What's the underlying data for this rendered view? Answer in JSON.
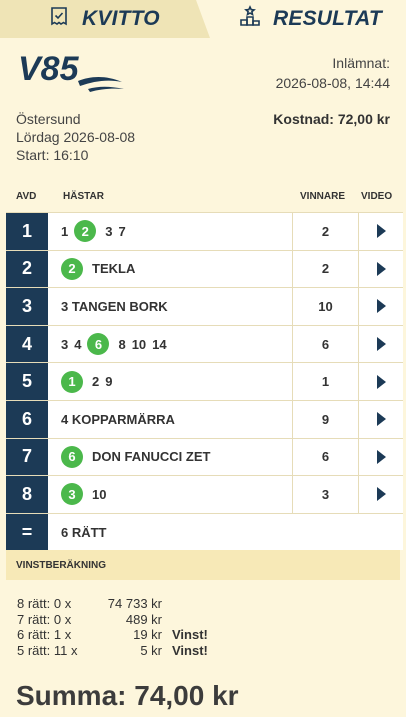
{
  "tabs": {
    "kvitto": "KVITTO",
    "resultat": "RESULTAT"
  },
  "header": {
    "logo": "V85",
    "inlamnat_label": "Inlämnat:",
    "inlamnat_value": "2026-08-08, 14:44",
    "track": "Östersund",
    "date": "Lördag 2026-08-08",
    "start": "Start: 16:10",
    "kostnad": "Kostnad: 72,00 kr"
  },
  "columns": {
    "avd": "AVD",
    "hastar": "HÄSTAR",
    "vinnare": "VINNARE",
    "video": "VIDEO"
  },
  "rows": [
    {
      "avd": "1",
      "horses": [
        {
          "t": "1",
          "w": false
        },
        {
          "t": "2",
          "w": true
        },
        {
          "t": "3",
          "w": false
        },
        {
          "t": "7",
          "w": false
        }
      ],
      "vinnare": "2"
    },
    {
      "avd": "2",
      "horses": [
        {
          "t": "2",
          "w": true
        },
        {
          "t": "TEKLA",
          "w": false
        }
      ],
      "vinnare": "2"
    },
    {
      "avd": "3",
      "horses": [
        {
          "t": "3 TANGEN BORK",
          "w": false
        }
      ],
      "vinnare": "10"
    },
    {
      "avd": "4",
      "horses": [
        {
          "t": "3",
          "w": false
        },
        {
          "t": "4",
          "w": false
        },
        {
          "t": "6",
          "w": true
        },
        {
          "t": "8",
          "w": false
        },
        {
          "t": "10",
          "w": false
        },
        {
          "t": "14",
          "w": false
        }
      ],
      "vinnare": "6"
    },
    {
      "avd": "5",
      "horses": [
        {
          "t": "1",
          "w": true
        },
        {
          "t": "2",
          "w": false
        },
        {
          "t": "9",
          "w": false
        }
      ],
      "vinnare": "1"
    },
    {
      "avd": "6",
      "horses": [
        {
          "t": "4 KOPPARMÄRRA",
          "w": false
        }
      ],
      "vinnare": "9"
    },
    {
      "avd": "7",
      "horses": [
        {
          "t": "6",
          "w": true
        },
        {
          "t": "DON FANUCCI ZET",
          "w": false
        }
      ],
      "vinnare": "6"
    },
    {
      "avd": "8",
      "horses": [
        {
          "t": "3",
          "w": true
        },
        {
          "t": "10",
          "w": false
        }
      ],
      "vinnare": "3"
    }
  ],
  "summary": {
    "symbol": "=",
    "text": "6 RÄTT"
  },
  "vinstberakning": {
    "title": "VINSTBERÄKNING",
    "lines": [
      {
        "label": "8 rätt: 0 x",
        "amount": "74 733 kr",
        "vinst": ""
      },
      {
        "label": "7 rätt: 0 x",
        "amount": "489 kr",
        "vinst": ""
      },
      {
        "label": "6 rätt: 1 x",
        "amount": "19 kr",
        "vinst": "Vinst!"
      },
      {
        "label": "5 rätt: 11 x",
        "amount": "5 kr",
        "vinst": "Vinst!"
      }
    ],
    "summa": "Summa: 74,00 kr"
  },
  "colors": {
    "navy": "#1c3a56",
    "green": "#4bb84b",
    "cream": "#fdf6dc",
    "tab": "#efe4b6"
  },
  "icons": {
    "kvitto": "receipt-check-icon",
    "resultat": "podium-icon",
    "video": "play-icon"
  }
}
